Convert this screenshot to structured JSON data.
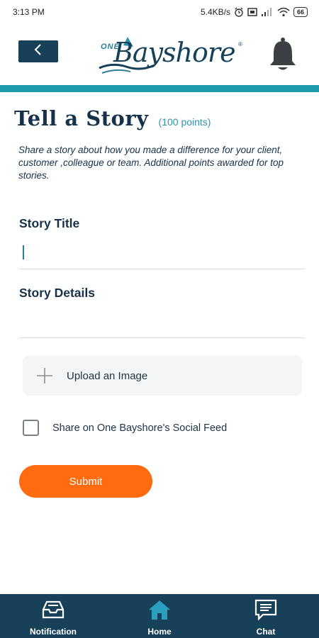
{
  "status_bar": {
    "time": "3:13 PM",
    "network_speed": "5.4KB/s",
    "battery": "66",
    "icons": [
      "alarm-icon",
      "screenshot-icon",
      "signal-icon",
      "wifi-icon",
      "battery-icon"
    ]
  },
  "header": {
    "back_icon": "chevron-left-icon",
    "logo_prefix": "ONE",
    "logo_name": "Bayshore",
    "logo_mark": "®",
    "notification_icon": "bell-icon",
    "accent_color": "#1f9cab",
    "brand_color": "#174059"
  },
  "main": {
    "title": "Tell a Story",
    "points": "(100 points)",
    "intro": "Share a story about how you made a difference for your client, customer ,colleague or team. Additional points awarded for top stories.",
    "story_title_label": "Story Title",
    "story_title_value": "",
    "story_details_label": "Story Details",
    "story_details_value": "",
    "upload_label": "Upload an Image",
    "share_label": "Share on One Bayshore's  Social Feed",
    "share_checked": false,
    "submit_label": "Submit",
    "submit_color": "#ff6b11"
  },
  "bottom_nav": {
    "items": [
      {
        "label": "Notification",
        "icon": "inbox-icon"
      },
      {
        "label": "Home",
        "icon": "home-icon",
        "active": true
      },
      {
        "label": "Chat",
        "icon": "chat-icon"
      }
    ],
    "active_color": "#2a9fc0"
  }
}
